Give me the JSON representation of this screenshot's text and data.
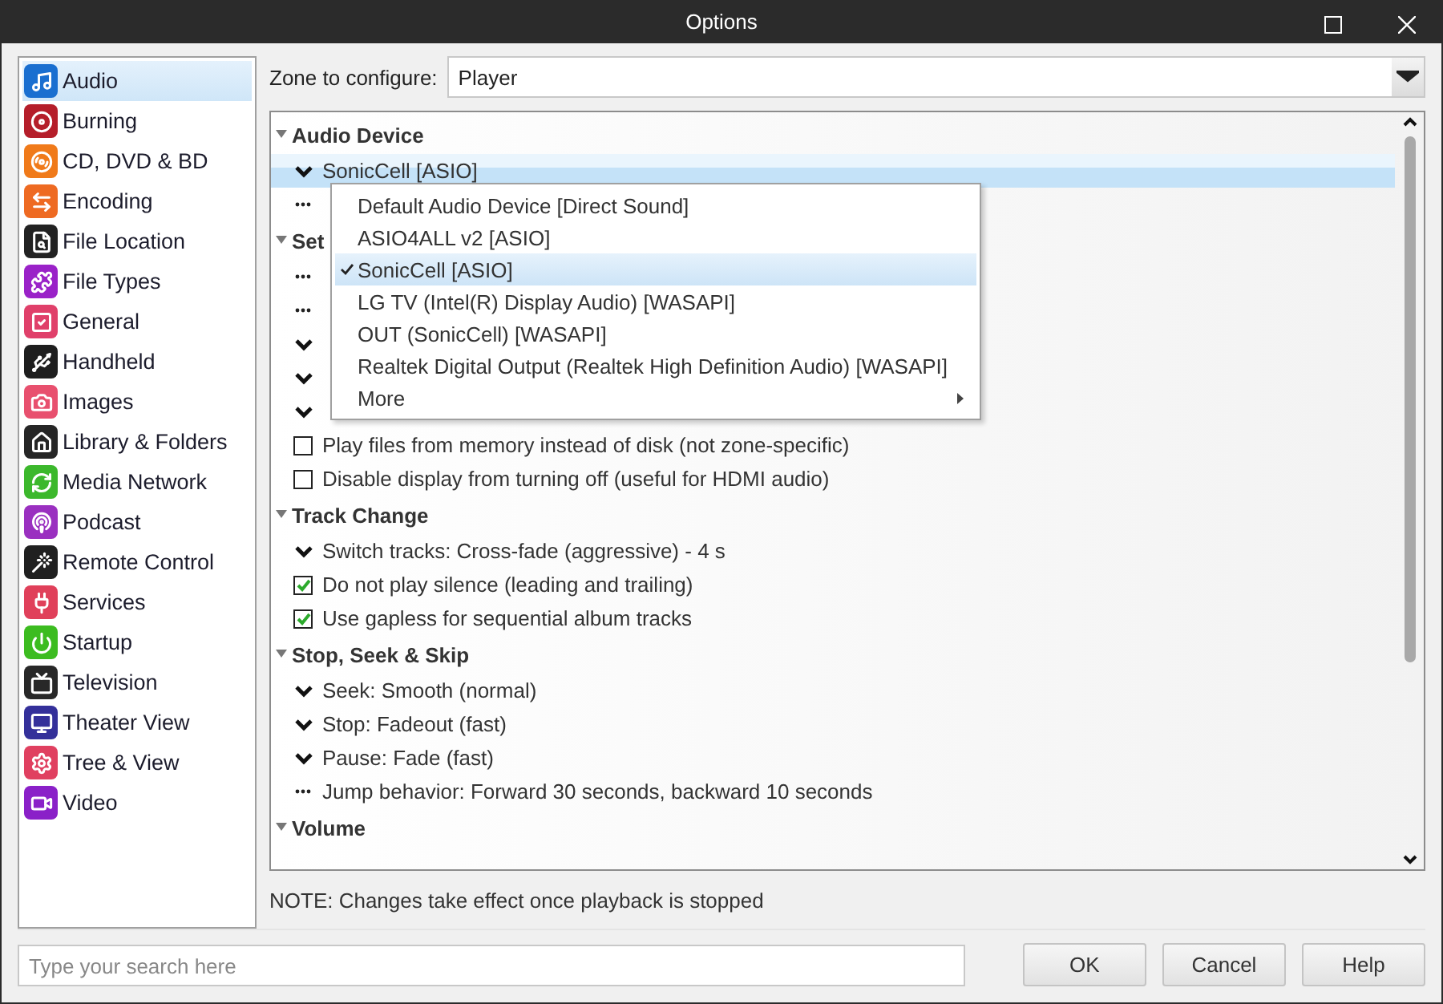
{
  "window": {
    "title": "Options"
  },
  "sidebar": {
    "items": [
      {
        "label": "Audio",
        "selected": true,
        "color": "#1a6fd0"
      },
      {
        "label": "Burning",
        "selected": false,
        "color": "#b51e2a"
      },
      {
        "label": "CD, DVD & BD",
        "selected": false,
        "color": "#f07a1a"
      },
      {
        "label": "Encoding",
        "selected": false,
        "color": "#ee6a22"
      },
      {
        "label": "File Location",
        "selected": false,
        "color": "#222222"
      },
      {
        "label": "File Types",
        "selected": false,
        "color": "#9a22c8"
      },
      {
        "label": "General",
        "selected": false,
        "color": "#e0406a"
      },
      {
        "label": "Handheld",
        "selected": false,
        "color": "#1e1e1e"
      },
      {
        "label": "Images",
        "selected": false,
        "color": "#e8506e"
      },
      {
        "label": "Library & Folders",
        "selected": false,
        "color": "#262626"
      },
      {
        "label": "Media Network",
        "selected": false,
        "color": "#3cb82c"
      },
      {
        "label": "Podcast",
        "selected": false,
        "color": "#9a30c0"
      },
      {
        "label": "Remote Control",
        "selected": false,
        "color": "#202020"
      },
      {
        "label": "Services",
        "selected": false,
        "color": "#e0405a"
      },
      {
        "label": "Startup",
        "selected": false,
        "color": "#3cbc20"
      },
      {
        "label": "Television",
        "selected": false,
        "color": "#282828"
      },
      {
        "label": "Theater View",
        "selected": false,
        "color": "#34309a"
      },
      {
        "label": "Tree & View",
        "selected": false,
        "color": "#e04060"
      },
      {
        "label": "Video",
        "selected": false,
        "color": "#8a20c8"
      }
    ]
  },
  "zone": {
    "label": "Zone to configure:",
    "value": "Player"
  },
  "tree": {
    "sections": [
      {
        "title": "Audio Device",
        "expanded": true,
        "rows": [
          {
            "kind": "dropdown",
            "text": "SonicCell [ASIO]",
            "selected": true
          },
          {
            "kind": "dialog",
            "selected": false
          }
        ]
      },
      {
        "title": "Set",
        "expanded": true,
        "rows": [
          {
            "kind": "dialog",
            "selected": false
          },
          {
            "kind": "dialog",
            "selected": false
          },
          {
            "kind": "dropdown",
            "selected": false
          },
          {
            "kind": "dropdown",
            "selected": false
          },
          {
            "kind": "dropdown",
            "selected": false
          },
          {
            "kind": "checkbox",
            "text": "Play files from memory instead of disk (not zone-specific)",
            "checked": false,
            "selected": false
          },
          {
            "kind": "checkbox",
            "text": "Disable display from turning off (useful for HDMI audio)",
            "checked": false,
            "selected": false
          }
        ]
      },
      {
        "title": "Track Change",
        "expanded": true,
        "rows": [
          {
            "kind": "dropdown",
            "text": "Switch tracks: Cross-fade (aggressive) - 4 s",
            "selected": false
          },
          {
            "kind": "checkbox",
            "text": "Do not play silence (leading and trailing)",
            "checked": true,
            "selected": false
          },
          {
            "kind": "checkbox",
            "text": "Use gapless for sequential album tracks",
            "checked": true,
            "selected": false
          }
        ]
      },
      {
        "title": "Stop, Seek & Skip",
        "expanded": true,
        "rows": [
          {
            "kind": "dropdown",
            "text": "Seek: Smooth (normal)",
            "selected": false
          },
          {
            "kind": "dropdown",
            "text": "Stop: Fadeout (fast)",
            "selected": false
          },
          {
            "kind": "dropdown",
            "text": "Pause: Fade (fast)",
            "selected": false
          },
          {
            "kind": "dialog",
            "text": "Jump behavior: Forward 30 seconds, backward 10 seconds",
            "selected": false
          }
        ]
      },
      {
        "title": "Volume",
        "expanded": true
      }
    ]
  },
  "menu": {
    "items": [
      {
        "label": "Default Audio Device [Direct Sound]",
        "checked": false,
        "selected": false,
        "submenu": false
      },
      {
        "label": "ASIO4ALL v2 [ASIO]",
        "checked": false,
        "selected": false,
        "submenu": false
      },
      {
        "label": "SonicCell [ASIO]",
        "checked": true,
        "selected": true,
        "submenu": false
      },
      {
        "label": "LG TV (Intel(R) Display Audio) [WASAPI]",
        "checked": false,
        "selected": false,
        "submenu": false
      },
      {
        "label": "OUT (SonicCell) [WASAPI]",
        "checked": false,
        "selected": false,
        "submenu": false
      },
      {
        "label": "Realtek Digital Output (Realtek High Definition Audio) [WASAPI]",
        "checked": false,
        "selected": false,
        "submenu": false
      },
      {
        "label": "More",
        "checked": false,
        "selected": false,
        "submenu": true
      }
    ]
  },
  "note": "NOTE: Changes take effect once playback is stopped",
  "search": {
    "placeholder": "Type your search here"
  },
  "buttons": [
    "OK",
    "Cancel",
    "Help"
  ]
}
